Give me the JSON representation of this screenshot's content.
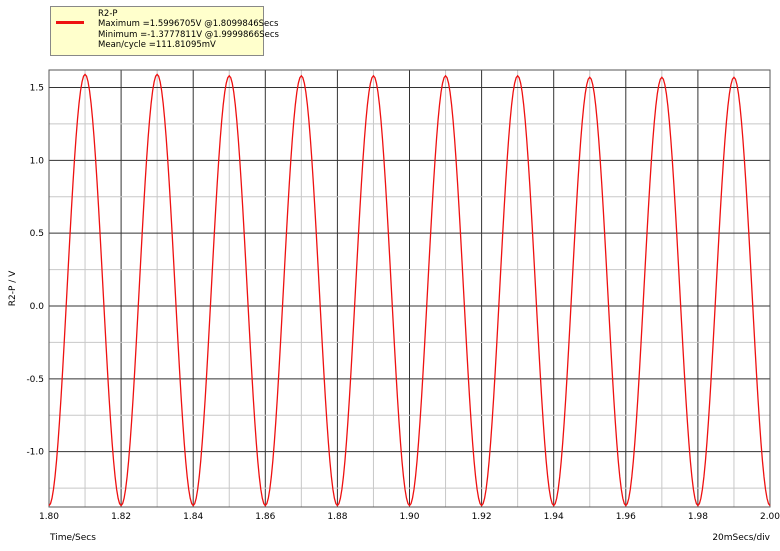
{
  "chart_data": {
    "type": "line",
    "xlabel": "Time/Secs",
    "ylabel": "R2-P / V",
    "xdiv_label": "20mSecs/div",
    "xlim": [
      1.8,
      2.0
    ],
    "ylim": [
      -1.38,
      1.62
    ],
    "xticks": [
      1.8,
      1.82,
      1.84,
      1.86,
      1.88,
      1.9,
      1.92,
      1.94,
      1.96,
      1.98,
      2.0
    ],
    "xtick_labels": [
      "1.80",
      "1.82",
      "1.84",
      "1.86",
      "1.88",
      "1.90",
      "1.92",
      "1.94",
      "1.96",
      "1.98",
      "2.00"
    ],
    "yticks": [
      1.5,
      1.0,
      0.5,
      0.0,
      -0.5,
      -1.0
    ],
    "ytick_labels": [
      "1.5",
      "1.0",
      "0.5",
      "0.0",
      "-0.5",
      "-1.0"
    ],
    "grid": true,
    "legend_position": "top-left",
    "series": [
      {
        "name": "R2-P",
        "color": "#ee1111",
        "x": [
          1.8,
          1.81,
          1.82,
          1.83,
          1.84,
          1.85,
          1.86,
          1.87,
          1.88,
          1.89,
          1.9,
          1.91,
          1.92,
          1.93,
          1.94,
          1.95,
          1.96,
          1.97,
          1.98,
          1.99,
          2.0
        ],
        "y": [
          -1.37,
          1.59,
          -1.37,
          1.59,
          -1.37,
          1.58,
          -1.37,
          1.58,
          -1.37,
          1.58,
          -1.37,
          1.58,
          -1.37,
          1.58,
          -1.37,
          1.57,
          -1.37,
          1.57,
          -1.37,
          1.57,
          -1.37
        ]
      }
    ]
  },
  "legend": {
    "name": "R2-P",
    "maximum": "Maximum =1.5996705V @1.8099846Secs",
    "minimum": "Minimum =-1.3777811V @1.9999866Secs",
    "mean": "Mean/cycle =111.81095mV"
  }
}
